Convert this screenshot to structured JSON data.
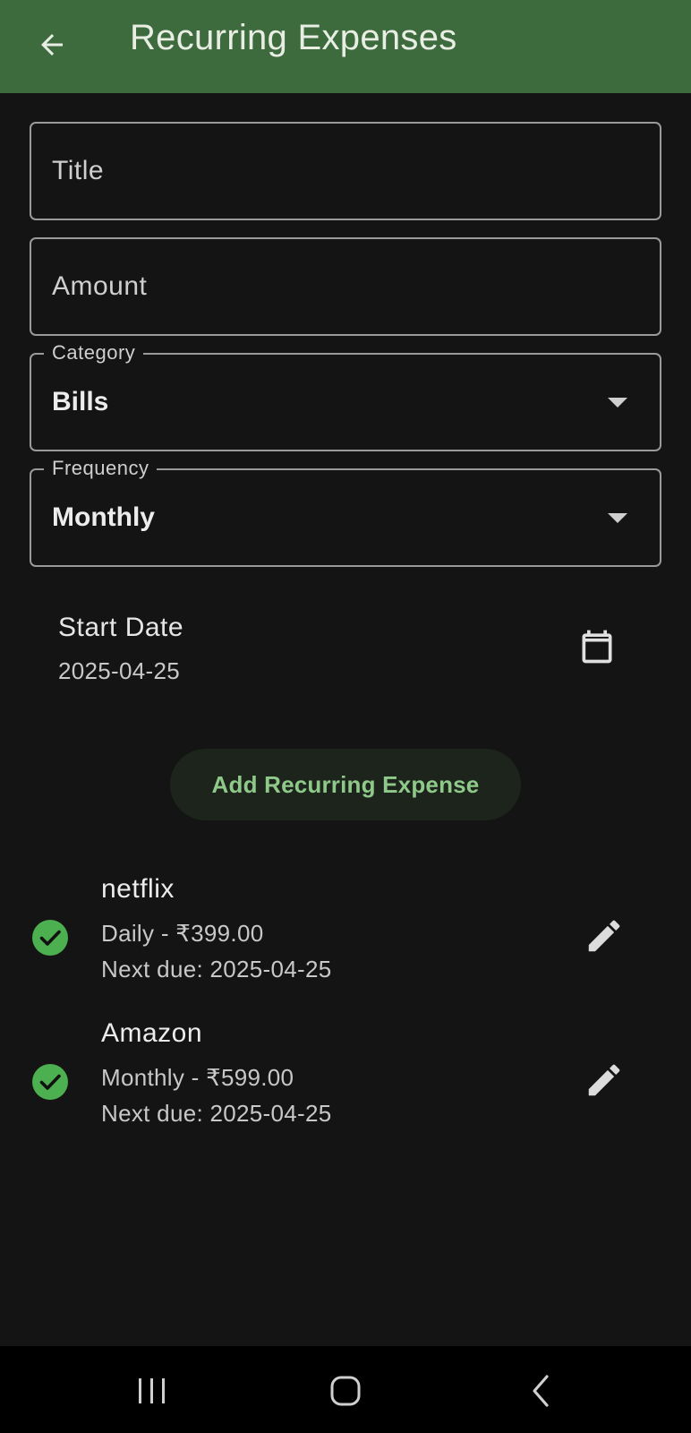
{
  "app_bar": {
    "title": "Recurring Expenses",
    "back_icon": "arrow-back-icon",
    "background_color": "#3e6b3e"
  },
  "form": {
    "title_field": {
      "placeholder": "Title",
      "value": ""
    },
    "amount_field": {
      "placeholder": "Amount",
      "value": ""
    },
    "category": {
      "label": "Category",
      "selected": "Bills"
    },
    "frequency": {
      "label": "Frequency",
      "selected": "Monthly"
    },
    "start_date": {
      "label": "Start Date",
      "value": "2025-04-25",
      "icon": "calendar-icon"
    },
    "add_button_label": "Add Recurring Expense"
  },
  "expenses": [
    {
      "name": "netflix",
      "summary": "Daily - ₹399.00",
      "next_due": "Next due: 2025-04-25",
      "status_icon": "check-circle-icon",
      "edit_icon": "edit-pencil-icon"
    },
    {
      "name": "Amazon",
      "summary": "Monthly - ₹599.00",
      "next_due": "Next due: 2025-04-25",
      "status_icon": "check-circle-icon",
      "edit_icon": "edit-pencil-icon"
    }
  ],
  "nav_bar": {
    "recents_icon": "recents-icon",
    "home_icon": "home-icon",
    "back_icon": "nav-back-icon"
  },
  "colors": {
    "accent": "#3e6b3e",
    "check_green": "#4caf50",
    "button_text": "#8fc98a",
    "background": "#141414"
  }
}
